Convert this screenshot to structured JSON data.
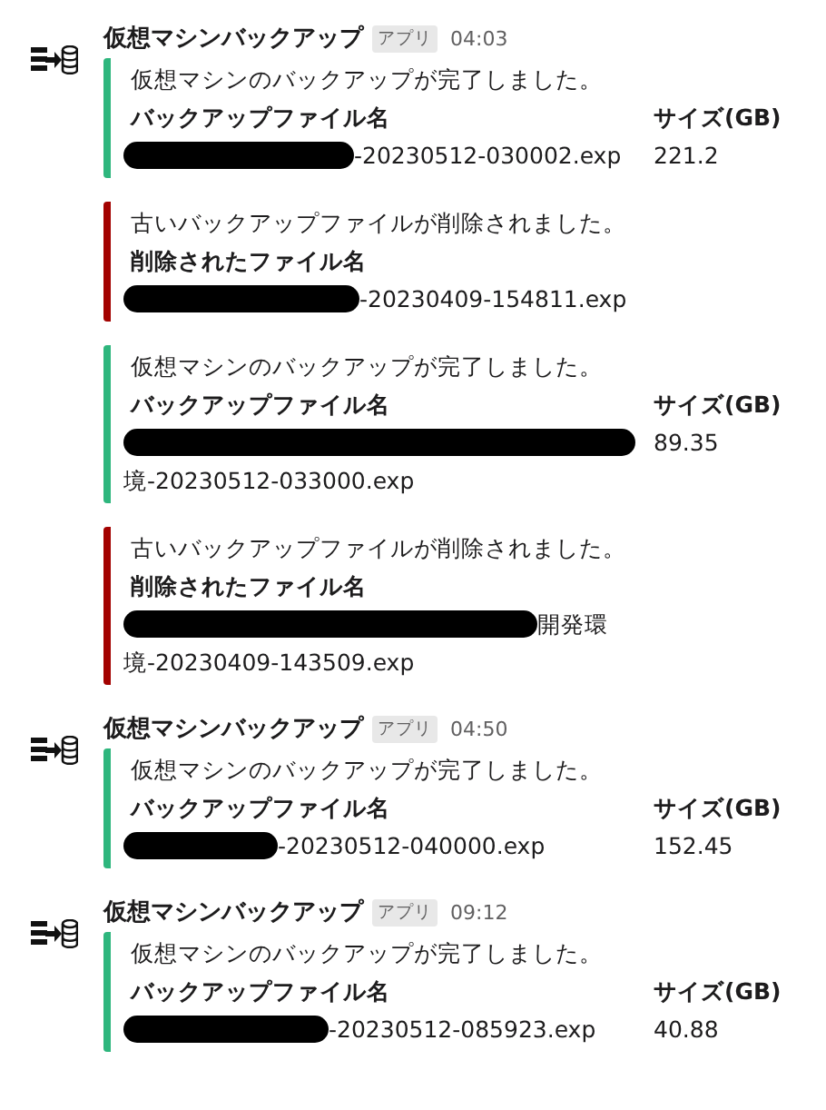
{
  "messages": [
    {
      "sender": "仮想マシンバックアップ",
      "badge": "アプリ",
      "time": "04:03",
      "attachments": [
        {
          "color": "#2eb67d",
          "text": "仮想マシンのバックアップが完了しました。",
          "fields": [
            {
              "label": "バックアップファイル名",
              "lines": [
                "-20230512-030002.exp"
              ],
              "redacted": true
            },
            {
              "label": "サイズ(GB)",
              "lines": [
                "221.2"
              ]
            }
          ]
        },
        {
          "color": "#a30200",
          "text": "古いバックアップファイルが削除されました。",
          "fields": [
            {
              "label": "削除されたファイル名",
              "lines": [
                "-20230409-154811.exp"
              ],
              "redacted": true
            }
          ]
        },
        {
          "color": "#2eb67d",
          "text": "仮想マシンのバックアップが完了しました。",
          "fields": [
            {
              "label": "バックアップファイル名",
              "lines": [
                "境-20230512-033000.exp"
              ],
              "redacted": true
            },
            {
              "label": "サイズ(GB)",
              "lines": [
                "89.35"
              ]
            }
          ]
        },
        {
          "color": "#a30200",
          "text": "古いバックアップファイルが削除されました。",
          "fields": [
            {
              "label": "削除されたファイル名",
              "lines": [
                "開発環",
                "境-20230409-143509.exp"
              ],
              "redacted": true
            }
          ]
        }
      ]
    },
    {
      "sender": "仮想マシンバックアップ",
      "badge": "アプリ",
      "time": "04:50",
      "attachments": [
        {
          "color": "#2eb67d",
          "text": "仮想マシンのバックアップが完了しました。",
          "fields": [
            {
              "label": "バックアップファイル名",
              "lines": [
                "-20230512-040000.exp"
              ],
              "redacted": true
            },
            {
              "label": "サイズ(GB)",
              "lines": [
                "152.45"
              ]
            }
          ]
        }
      ]
    },
    {
      "sender": "仮想マシンバックアップ",
      "badge": "アプリ",
      "time": "09:12",
      "attachments": [
        {
          "color": "#2eb67d",
          "text": "仮想マシンのバックアップが完了しました。",
          "fields": [
            {
              "label": "バックアップファイル名",
              "lines": [
                "-20230512-085923.exp"
              ],
              "redacted": true
            },
            {
              "label": "サイズ(GB)",
              "lines": [
                "40.88"
              ]
            }
          ]
        }
      ]
    }
  ]
}
